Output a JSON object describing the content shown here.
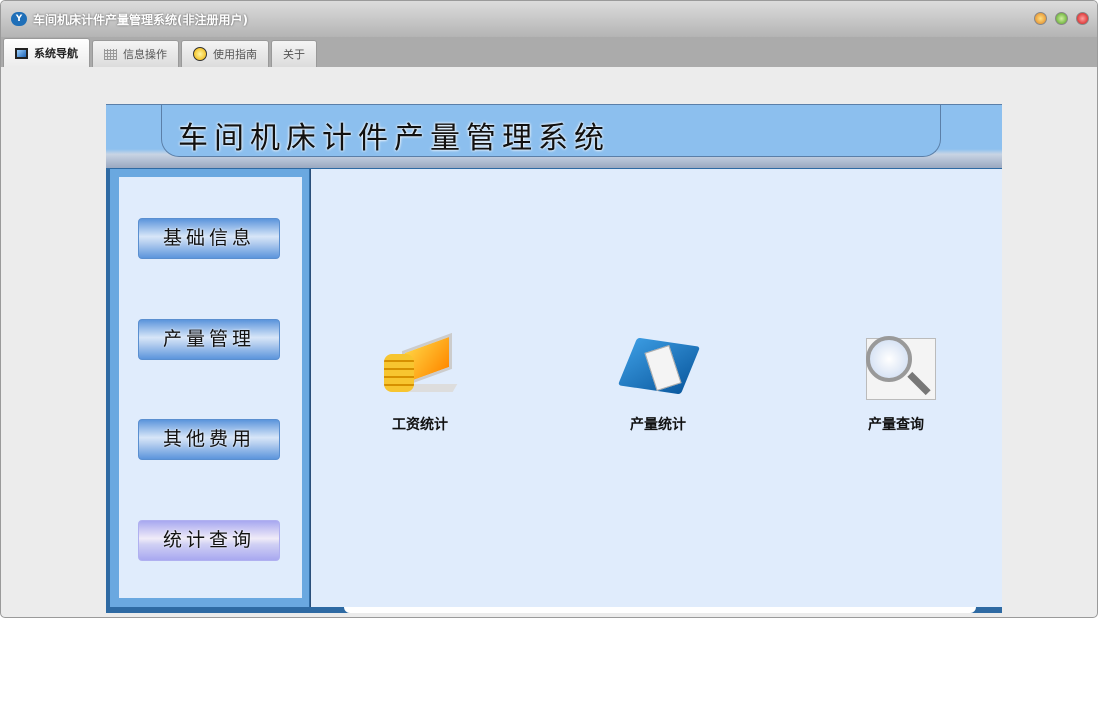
{
  "window": {
    "title": "车间机床计件产量管理系统(非注册用户)",
    "logo_text": "Y"
  },
  "tabs": [
    {
      "label": "系统导航",
      "icon": "monitor-icon",
      "active": true
    },
    {
      "label": "信息操作",
      "icon": "grid-icon"
    },
    {
      "label": "使用指南",
      "icon": "help-icon"
    },
    {
      "label": "关于"
    }
  ],
  "banner": {
    "title": "车间机床计件产量管理系统"
  },
  "sidebar": {
    "buttons": [
      "基础信息",
      "产量管理",
      "其他费用",
      "统计查询"
    ]
  },
  "main": {
    "items": [
      {
        "label": "工资统计",
        "icon": "salary-icon"
      },
      {
        "label": "产量统计",
        "icon": "book-icon"
      },
      {
        "label": "产量查询",
        "icon": "magnifier-icon"
      }
    ]
  }
}
